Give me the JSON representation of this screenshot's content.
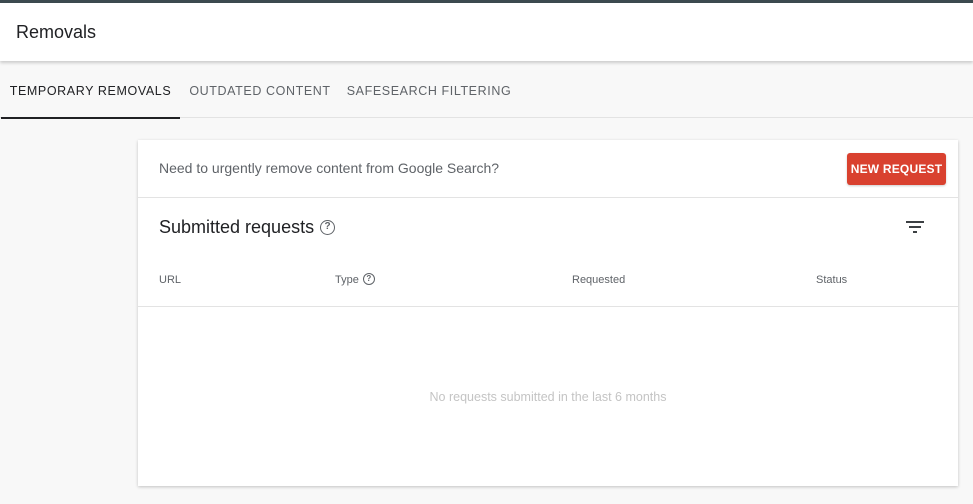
{
  "header": {
    "title": "Removals"
  },
  "tabs": [
    {
      "label": "TEMPORARY REMOVALS",
      "active": true
    },
    {
      "label": "OUTDATED CONTENT",
      "active": false
    },
    {
      "label": "SAFESEARCH FILTERING",
      "active": false
    }
  ],
  "urgent": {
    "text": "Need to urgently remove content from Google Search?",
    "button_label": "NEW REQUEST"
  },
  "requests": {
    "title": "Submitted requests",
    "columns": [
      "URL",
      "Type",
      "Requested",
      "Status"
    ],
    "empty_message": "No requests submitted in the last 6 months"
  },
  "icons": {
    "help": "help-circle-icon",
    "filter": "filter-icon"
  },
  "colors": {
    "accent_button": "#d9412f",
    "top_bar": "#3c4a4f"
  }
}
